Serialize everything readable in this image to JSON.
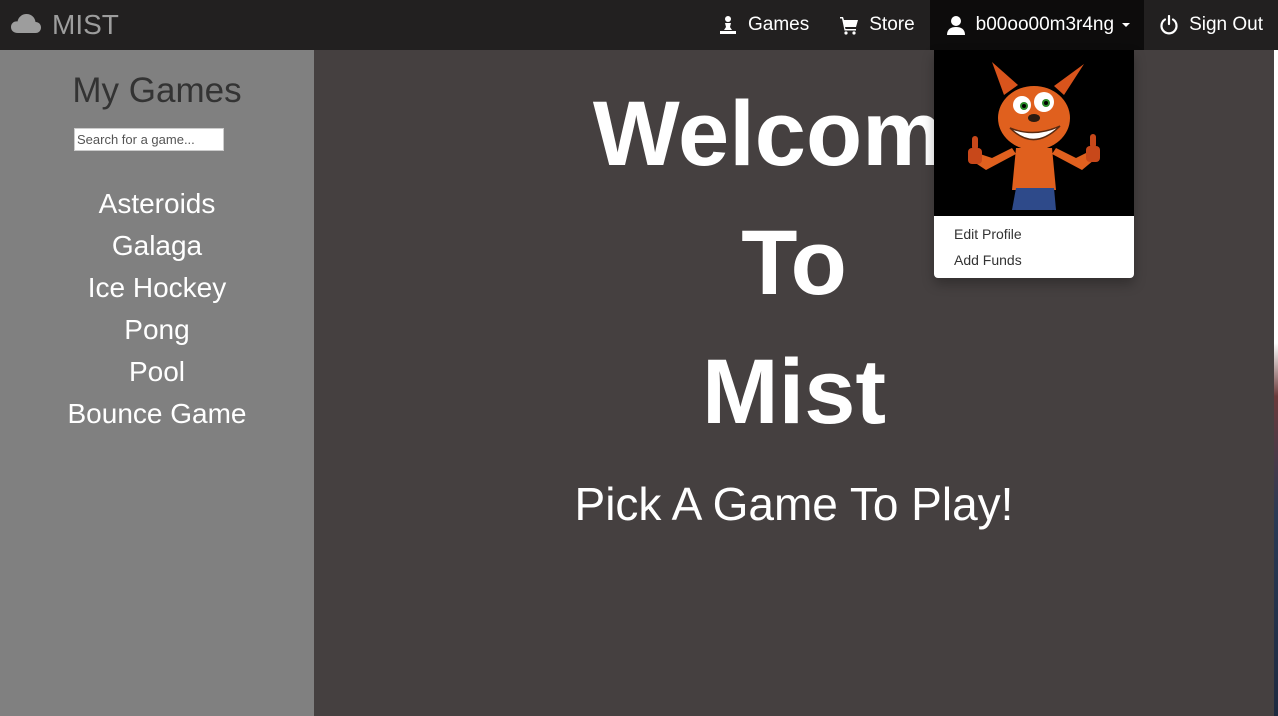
{
  "navbar": {
    "brand": "MIST",
    "games_label": "Games",
    "store_label": "Store",
    "username": "b00oo00m3r4ng",
    "signout_label": "Sign Out"
  },
  "sidebar": {
    "title": "My Games",
    "search_placeholder": "Search for a game...",
    "games": [
      "Asteroids",
      "Galaga",
      "Ice Hockey",
      "Pong",
      "Pool",
      "Bounce Game"
    ]
  },
  "main": {
    "welcome_lines": [
      "Welcome",
      "To",
      "Mist"
    ],
    "tagline": "Pick A Game To Play!"
  },
  "user_menu": {
    "items": [
      "Edit Profile",
      "Add Funds"
    ]
  },
  "icons": {
    "brand": "cloud-icon",
    "games": "pawn-icon",
    "store": "shopping-cart-icon",
    "user": "user-icon",
    "signout": "power-icon"
  },
  "colors": {
    "navbar": "#222020",
    "sidebar": "#808080",
    "main": "#454040",
    "text": "#ffffff"
  }
}
